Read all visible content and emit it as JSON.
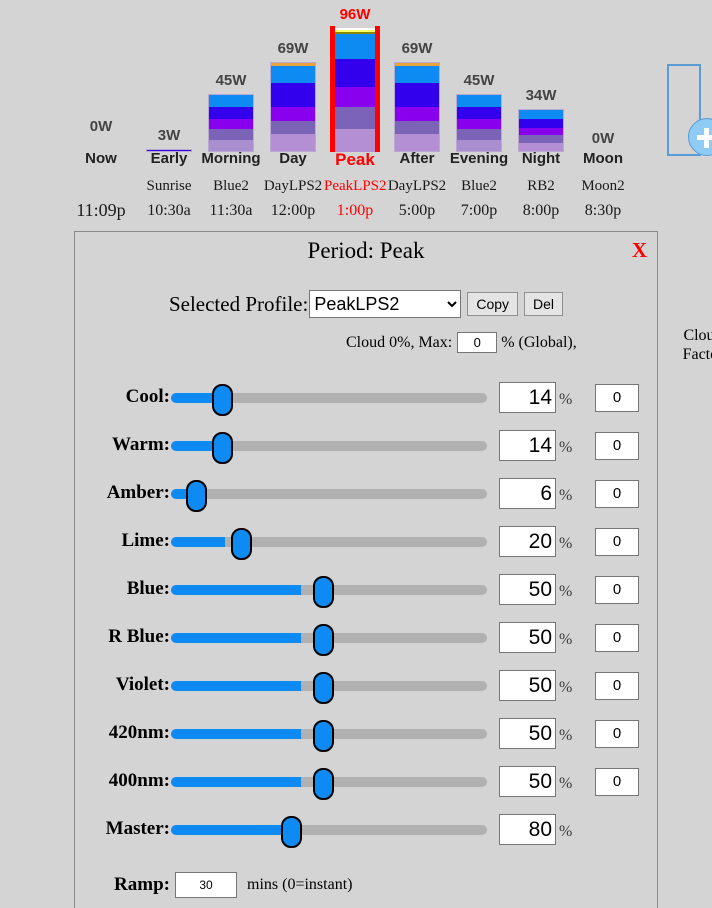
{
  "timeline": {
    "now": {
      "watts": "0W",
      "name": "Now",
      "time": "11:09p"
    },
    "periods": [
      {
        "watts": "3W",
        "name": "Early",
        "profile": "Sunrise",
        "time": "10:30a",
        "selected": false,
        "height": 3,
        "segments": []
      },
      {
        "watts": "45W",
        "name": "Morning",
        "profile": "Blue2",
        "time": "11:30a",
        "selected": false,
        "height": 58,
        "segments": [
          {
            "color": "#a98ed0",
            "h": 11
          },
          {
            "color": "#7b63b8",
            "h": 12
          },
          {
            "color": "#8800ee",
            "h": 10
          },
          {
            "color": "#3300ee",
            "h": 13
          },
          {
            "color": "#0d8bf2",
            "h": 12
          }
        ]
      },
      {
        "watts": "69W",
        "name": "Day",
        "profile": "DayLPS2",
        "time": "12:00p",
        "selected": false,
        "height": 90,
        "segments": [
          {
            "color": "#b48fd4",
            "h": 17
          },
          {
            "color": "#7b63b8",
            "h": 14
          },
          {
            "color": "#8800ee",
            "h": 14
          },
          {
            "color": "#3300ee",
            "h": 25
          },
          {
            "color": "#0d8bf2",
            "h": 17
          },
          {
            "color": "#e8a33d",
            "h": 3
          }
        ]
      },
      {
        "watts": "96W",
        "name": "Peak",
        "profile": "PeakLPS2",
        "time": "1:00p",
        "selected": true,
        "height": 124,
        "segments": [
          {
            "color": "#b48fd4",
            "h": 23
          },
          {
            "color": "#7b63b8",
            "h": 22
          },
          {
            "color": "#8800ee",
            "h": 20
          },
          {
            "color": "#3300ee",
            "h": 28
          },
          {
            "color": "#0d8bf2",
            "h": 25
          },
          {
            "color": "#8a8a00",
            "h": 2
          },
          {
            "color": "#ffff66",
            "h": 2
          },
          {
            "color": "#ffffff",
            "h": 2
          }
        ]
      },
      {
        "watts": "69W",
        "name": "After",
        "profile": "DayLPS2",
        "time": "5:00p",
        "selected": false,
        "height": 90,
        "segments": [
          {
            "color": "#b48fd4",
            "h": 17
          },
          {
            "color": "#7b63b8",
            "h": 14
          },
          {
            "color": "#8800ee",
            "h": 14
          },
          {
            "color": "#3300ee",
            "h": 25
          },
          {
            "color": "#0d8bf2",
            "h": 17
          },
          {
            "color": "#e8a33d",
            "h": 3
          }
        ]
      },
      {
        "watts": "45W",
        "name": "Evening",
        "profile": "Blue2",
        "time": "7:00p",
        "selected": false,
        "height": 58,
        "segments": [
          {
            "color": "#a98ed0",
            "h": 11
          },
          {
            "color": "#7b63b8",
            "h": 12
          },
          {
            "color": "#8800ee",
            "h": 10
          },
          {
            "color": "#3300ee",
            "h": 13
          },
          {
            "color": "#0d8bf2",
            "h": 12
          }
        ]
      },
      {
        "watts": "34W",
        "name": "Night",
        "profile": "RB2",
        "time": "8:00p",
        "selected": false,
        "height": 43,
        "segments": [
          {
            "color": "#b48fd4",
            "h": 8
          },
          {
            "color": "#7b63b8",
            "h": 9
          },
          {
            "color": "#8800ee",
            "h": 7
          },
          {
            "color": "#3300ee",
            "h": 10
          },
          {
            "color": "#0d8bf2",
            "h": 9
          }
        ]
      },
      {
        "watts": "0W",
        "name": "Moon",
        "profile": "Moon2",
        "time": "8:30p",
        "selected": false,
        "height": 0,
        "segments": []
      }
    ],
    "add_period_icon": "add-period-plus-icon"
  },
  "panel": {
    "title": "Period: Peak",
    "close_label": "X",
    "profile_label": "Selected Profile:",
    "selected_profile": "PeakLPS2",
    "profile_options": [
      "PeakLPS2"
    ],
    "copy_label": "Copy",
    "del_label": "Del",
    "cloud_prefix": "Cloud 0%, Max:",
    "cloud_max_value": "0",
    "cloud_suffix": "% (Global),",
    "cloud_factor_head_line1": "Cloud",
    "cloud_factor_head_line2": "Factor",
    "percent_symbol": "%",
    "channels": [
      {
        "label": "Cool:",
        "value": "14",
        "cloud_factor": "0",
        "fill_pct": 14,
        "thumb_pct": 16
      },
      {
        "label": "Warm:",
        "value": "14",
        "cloud_factor": "0",
        "fill_pct": 14,
        "thumb_pct": 16
      },
      {
        "label": "Amber:",
        "value": "6",
        "cloud_factor": "0",
        "fill_pct": 5,
        "thumb_pct": 8
      },
      {
        "label": "Lime:",
        "value": "20",
        "cloud_factor": "0",
        "fill_pct": 17,
        "thumb_pct": 22
      },
      {
        "label": "Blue:",
        "value": "50",
        "cloud_factor": "0",
        "fill_pct": 41,
        "thumb_pct": 48
      },
      {
        "label": "R Blue:",
        "value": "50",
        "cloud_factor": "0",
        "fill_pct": 41,
        "thumb_pct": 48
      },
      {
        "label": "Violet:",
        "value": "50",
        "cloud_factor": "0",
        "fill_pct": 41,
        "thumb_pct": 48
      },
      {
        "label": "420nm:",
        "value": "50",
        "cloud_factor": "0",
        "fill_pct": 41,
        "thumb_pct": 48
      },
      {
        "label": "400nm:",
        "value": "50",
        "cloud_factor": "0",
        "fill_pct": 41,
        "thumb_pct": 48
      },
      {
        "label": "Master:",
        "value": "80",
        "cloud_factor": null,
        "fill_pct": 36,
        "thumb_pct": 38
      }
    ],
    "ramp_label": "Ramp:",
    "ramp_value": "30",
    "ramp_hint": "mins (0=instant)"
  },
  "colors": {
    "background": "#d4d4d4",
    "accent": "#0d8bf2",
    "selected": "#ff0000",
    "track": "#b0b0b0",
    "panel_border": "#8a8a8a"
  }
}
